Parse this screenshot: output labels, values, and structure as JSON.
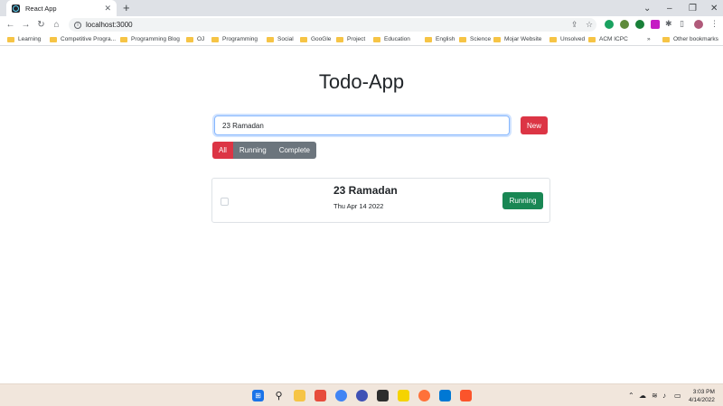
{
  "browser": {
    "tab_title": "React App",
    "tab_close": "✕",
    "new_tab": "+",
    "url": "localhost:3000",
    "bookmarks": [
      "Learning",
      "Competitive Progra...",
      "Programming Blog",
      "OJ",
      "Programming",
      "Social",
      "GooGle",
      "Project",
      "Education",
      "English",
      "Science",
      "Mojar Website",
      "Unsolved",
      "ACM ICPC"
    ],
    "bookmarks_overflow": "»",
    "other_bookmarks": "Other bookmarks"
  },
  "app": {
    "title": "Todo-App",
    "input_value": "23 Ramadan",
    "new_button": "New",
    "filters": [
      "All",
      "Running",
      "Complete"
    ],
    "active_filter": "All"
  },
  "todos": [
    {
      "title": "23 Ramadan",
      "date": "Thu Apr 14 2022",
      "status": "Running",
      "status_color": "#198754",
      "checked": false
    }
  ],
  "colors": {
    "accent": "#dc3545",
    "success": "#198754",
    "secondary": "#6c757d"
  },
  "taskbar": {
    "time": "3:03 PM",
    "date": "4/14/2022"
  }
}
